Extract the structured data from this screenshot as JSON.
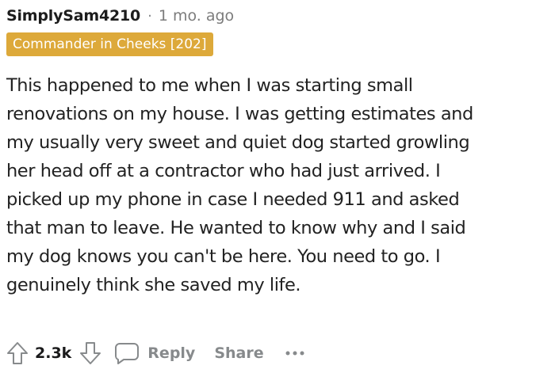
{
  "comment": {
    "username": "SimplySam4210",
    "separator": "·",
    "age": "1 mo. ago",
    "flair": "Commander in Cheeks [202]",
    "body_lines": [
      "This happened to me when I was starting small",
      "renovations on my house. I was getting estimates and",
      "my usually very sweet and quiet dog started growling",
      "her head off at a contractor who had just arrived. I",
      "picked up my phone in case I needed 911 and asked",
      "that man to leave. He wanted to know why and I said",
      "my dog knows you can't be here. You need to go. I",
      "genuinely think she saved my life."
    ]
  },
  "actions": {
    "upvote_icon": "arrow-up-icon",
    "score": "2.3k",
    "downvote_icon": "arrow-down-icon",
    "reply_icon": "speech-bubble-icon",
    "reply_label": "Reply",
    "share_label": "Share",
    "more_icon": "ellipsis-icon"
  },
  "colors": {
    "flair_background": "#dda93a",
    "flair_text": "#ffffff",
    "muted_text": "#878a8c",
    "icon_stroke": "#878a8c"
  }
}
